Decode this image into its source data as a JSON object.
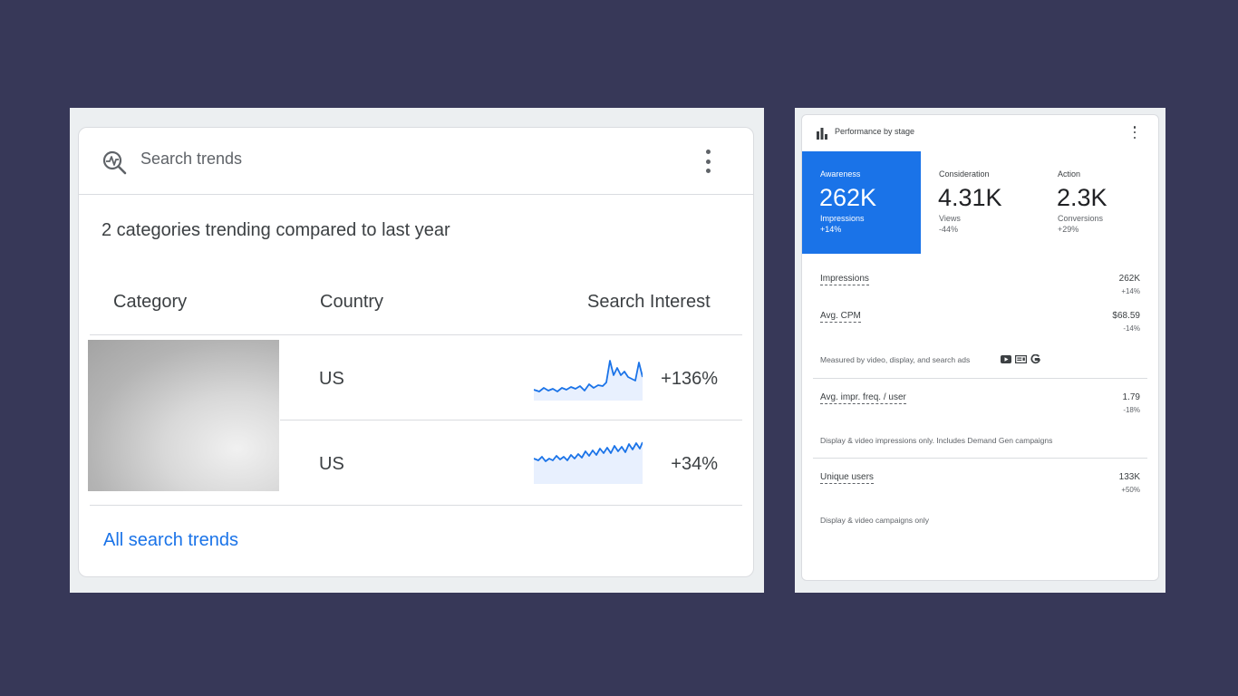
{
  "search_trends": {
    "title": "Search trends",
    "subtitle": "2 categories trending compared to last year",
    "columns": {
      "category": "Category",
      "country": "Country",
      "interest": "Search Interest"
    },
    "rows": [
      {
        "country": "US",
        "change": "+136%"
      },
      {
        "country": "US",
        "change": "+34%"
      }
    ],
    "link": "All search trends"
  },
  "performance": {
    "title": "Performance by stage",
    "stages": [
      {
        "name": "Awareness",
        "value": "262K",
        "metric": "Impressions",
        "change": "+14%"
      },
      {
        "name": "Consideration",
        "value": "4.31K",
        "metric": "Views",
        "change": "-44%"
      },
      {
        "name": "Action",
        "value": "2.3K",
        "metric": "Conversions",
        "change": "+29%"
      }
    ],
    "metrics": [
      {
        "label": "Impressions",
        "value": "262K",
        "change": "+14%"
      },
      {
        "label": "Avg. CPM",
        "value": "$68.59",
        "change": "-14%"
      },
      {
        "label": "Avg. impr. freq. / user",
        "value": "1.79",
        "change": "-18%"
      },
      {
        "label": "Unique users",
        "value": "133K",
        "change": "+50%"
      }
    ],
    "notes": {
      "measured": "Measured by video, display, and search ads",
      "freq": "Display & video impressions only. Includes Demand Gen campaigns",
      "users": "Display & video campaigns only"
    }
  },
  "colors": {
    "background": "#373858",
    "accent": "#1a73e8",
    "sparkline": "#1a73e8",
    "sparkline_fill": "#e8f0fe"
  },
  "icons": [
    "search-trends-icon",
    "more-vert-icon",
    "bar-chart-icon",
    "youtube-icon",
    "display-icon",
    "google-icon"
  ]
}
